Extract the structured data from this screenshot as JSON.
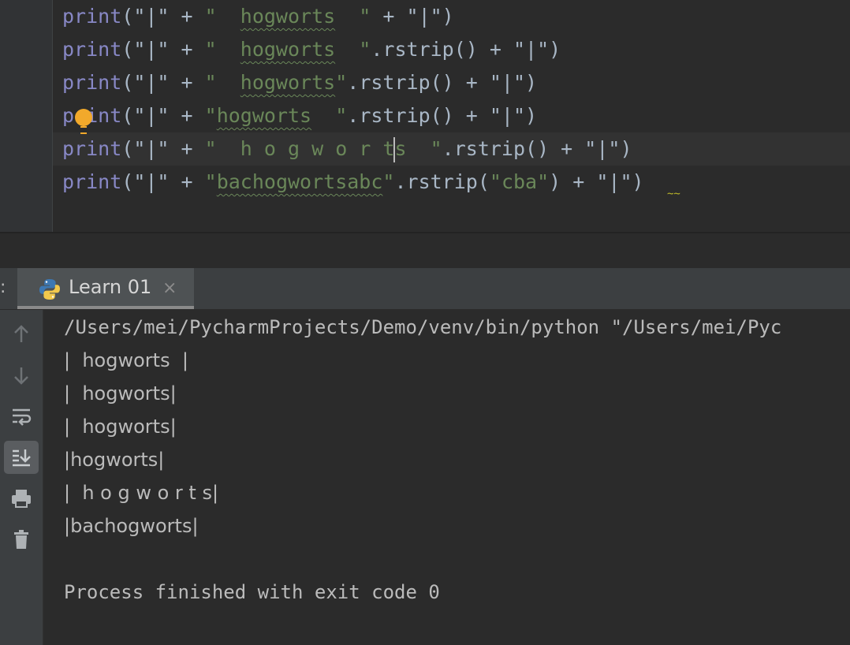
{
  "editor": {
    "lines": [
      {
        "fn": "print",
        "p1": "(\"|\" + ",
        "s1": "\"  ",
        "w": "hogworts",
        "s2": "  \"",
        "p2": " + \"|\")"
      },
      {
        "fn": "print",
        "p1": "(\"|\" + ",
        "s1": "\"  ",
        "w": "hogworts",
        "s2": "  \"",
        "p2": ".rstrip() + \"|\")"
      },
      {
        "fn": "print",
        "p1": "(\"|\" + ",
        "s1": "\"  ",
        "w": "hogworts",
        "s2": "\"",
        "p2": ".rstrip() + \"|\")"
      },
      {
        "fn": "print",
        "p1": "(\"|\" + ",
        "s1": "\"",
        "w": "hogworts",
        "s2": "  \"",
        "p2": ".rstrip() + \"|\")"
      },
      {
        "fn": "print",
        "p1": "(\"|\" + ",
        "s1": "\"  h o g w o r t",
        "s1b": "s  \"",
        "p2": ".rstrip() + \"|\")"
      },
      {
        "fn": "print",
        "p1": "(\"|\" + ",
        "s1": "\"",
        "w": "bachogwortsabc",
        "s2": "\"",
        "p2a": ".rstrip(",
        "s3": "\"cba\"",
        "p2": ") + \"|\")"
      }
    ]
  },
  "run_panel": {
    "prefix": ":",
    "tab_label": "Learn 01",
    "close_glyph": "×"
  },
  "toolbar": {
    "icons": [
      "up-arrow-icon",
      "down-arrow-icon",
      "soft-wrap-icon",
      "scroll-to-end-icon",
      "print-icon",
      "trash-icon"
    ]
  },
  "console": {
    "command": "/Users/mei/PycharmProjects/Demo/venv/bin/python \"/Users/mei/Pyc",
    "outputs": [
      "|  hogworts  |",
      "|  hogworts|",
      "|  hogworts|",
      "|hogworts|",
      "|  h o g w o r t s|",
      "|bachogworts|"
    ],
    "exit_message": "Process finished with exit code 0"
  }
}
